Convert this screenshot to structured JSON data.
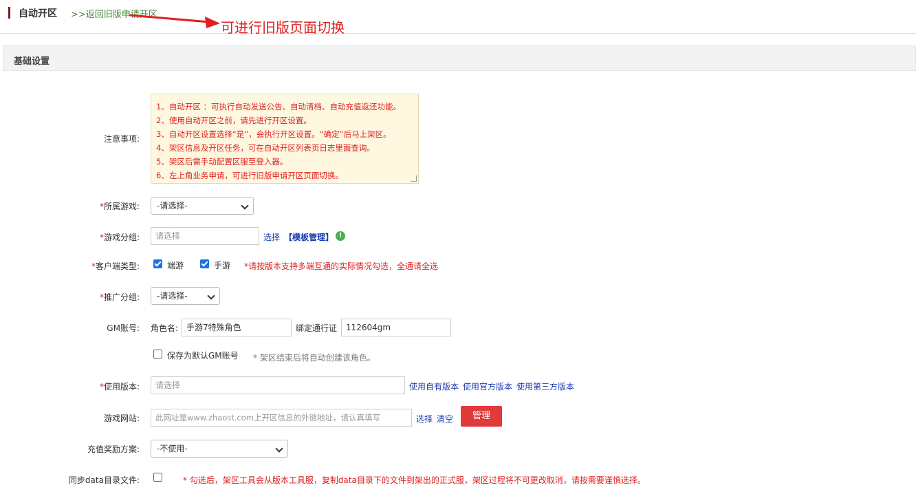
{
  "header": {
    "title": "自动开区",
    "back_link": ">>返回旧版申请开区",
    "annotation": "可进行旧版页面切换"
  },
  "section": {
    "title": "基础设置"
  },
  "notice": {
    "label": "注意事项:",
    "lines": [
      "1、自动开区 ：可执行自动发送公告、自动清档、自动充值返还功能。",
      "2、使用自动开区之前，请先进行开区设置。",
      "3、自动开区设置选择“是”，会执行开区设置。“确定”后马上架区。",
      "4、架区信息及开区任务，可在自动开区列表页日志里面查询。",
      "5、架区后需手动配置区服至登入器。",
      "6、左上角业务申请，可进行旧版申请开区页面切换。"
    ]
  },
  "form": {
    "game": {
      "label": "所属游戏:",
      "value": "-请选择-"
    },
    "game_group": {
      "label": "游戏分组:",
      "placeholder": "请选择",
      "select_link": "选择",
      "template_link": "【模板管理】",
      "info_icon": "!"
    },
    "client_type": {
      "label": "客户端类型:",
      "opt1": "端游",
      "opt2": "手游",
      "hint": "*请按版本支持多端互通的实际情况勾选，全通请全选"
    },
    "promo_group": {
      "label": "推广分组:",
      "value": "-请选择-"
    },
    "gm": {
      "label": "GM账号:",
      "role_label": "角色名:",
      "role_value": "手游7特殊角色",
      "pass_label": "绑定通行证",
      "pass_value": "112604gm",
      "save_default": "保存为默认GM账号",
      "hint": "* 架区结束后将自动创建该角色。"
    },
    "version": {
      "label": "使用版本:",
      "placeholder": "请选择",
      "own": "使用自有版本",
      "official": "使用官方版本",
      "third": "使用第三方版本"
    },
    "website": {
      "label": "游戏网站:",
      "placeholder": "此网址是www.zhaost.com上开区信息的外链地址，请认真填写",
      "select_link": "选择",
      "clear_link": "清空",
      "manage_button": "管理"
    },
    "recharge": {
      "label": "充值奖励方案:",
      "value": "-不使用-"
    },
    "sync": {
      "label": "同步data目录文件:",
      "hint": "* 勾选后，架区工具会从版本工具服，复制data目录下的文件到架出的正式服，架区过程将不可更改取消，请按需要谨慎选择。"
    }
  },
  "required_mark": "*",
  "colors": {
    "accent": "#e03a3a",
    "link": "#1a3bb0",
    "warning": "#e02020",
    "checkbox": "#1a73e8"
  }
}
